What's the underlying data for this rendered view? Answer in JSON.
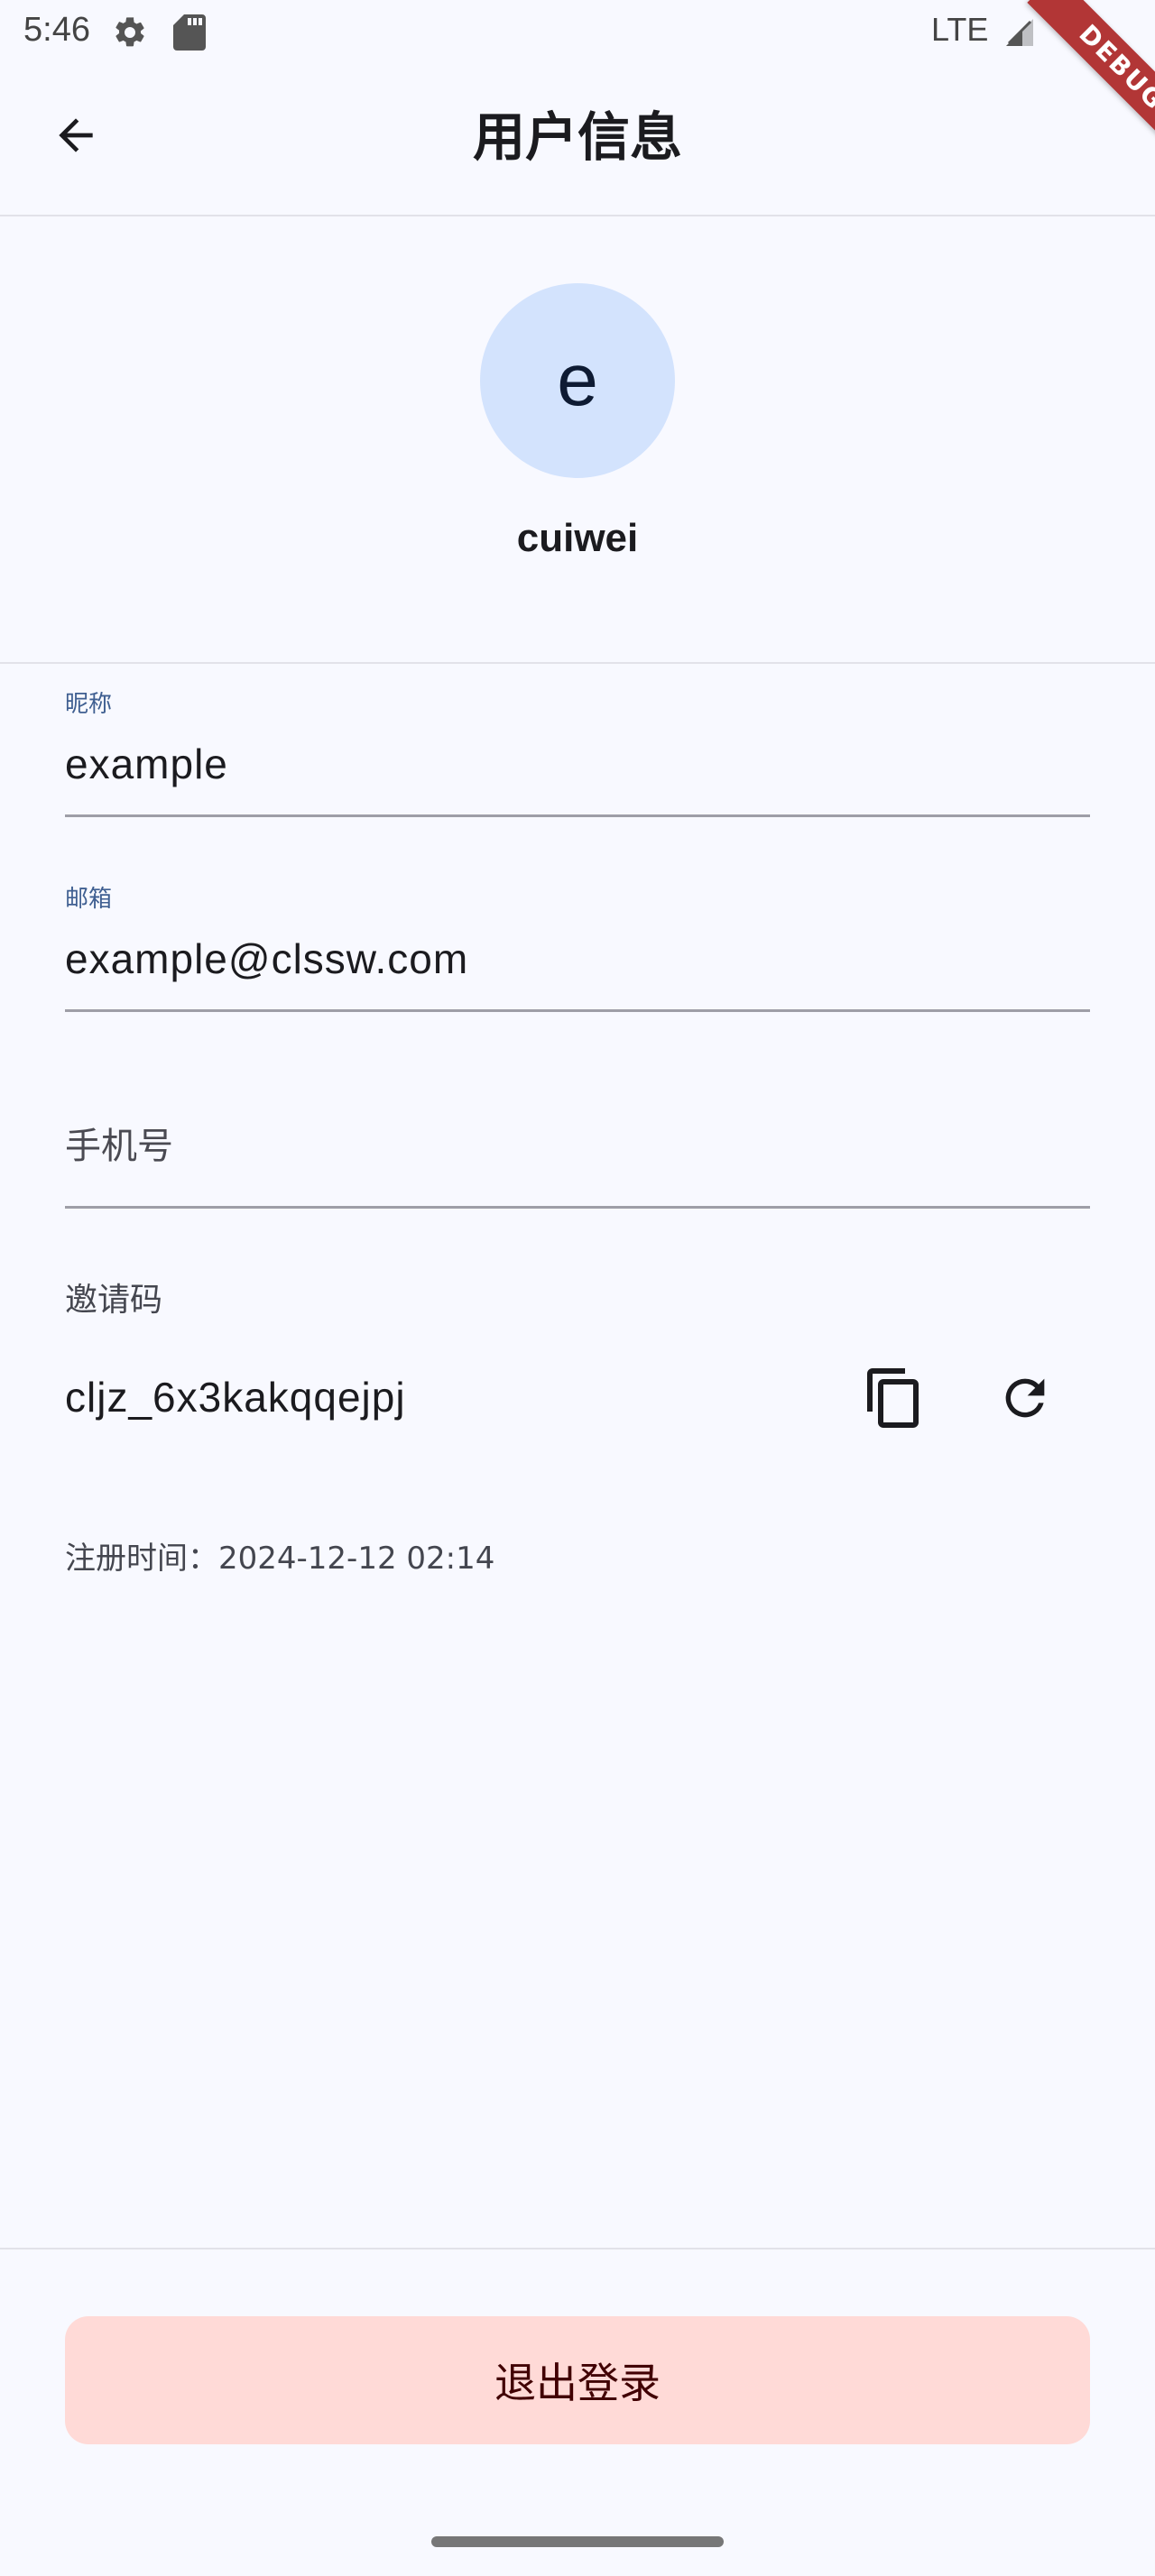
{
  "status_bar": {
    "time": "5:46",
    "network": "LTE",
    "icons": [
      "gear-icon",
      "sd-card-icon",
      "signal-icon"
    ],
    "debug_banner": "DEBUG"
  },
  "app_bar": {
    "back_icon": "arrow-back-icon",
    "title": "用户信息"
  },
  "profile": {
    "avatar_letter": "e",
    "username": "cuiwei",
    "avatar_color": "#d3e3fd"
  },
  "form": {
    "nickname": {
      "label": "昵称",
      "value": "example"
    },
    "email": {
      "label": "邮箱",
      "value": "example@clssw.com"
    },
    "phone": {
      "placeholder": "手机号",
      "value": ""
    }
  },
  "invite": {
    "label": "邀请码",
    "code": "cljz_6x3kakqqejpj",
    "copy_icon": "copy-icon",
    "refresh_icon": "refresh-icon"
  },
  "register_time": "注册时间：2024-12-12 02:14",
  "logout": {
    "label": "退出登录",
    "color": "#ffdad7"
  }
}
